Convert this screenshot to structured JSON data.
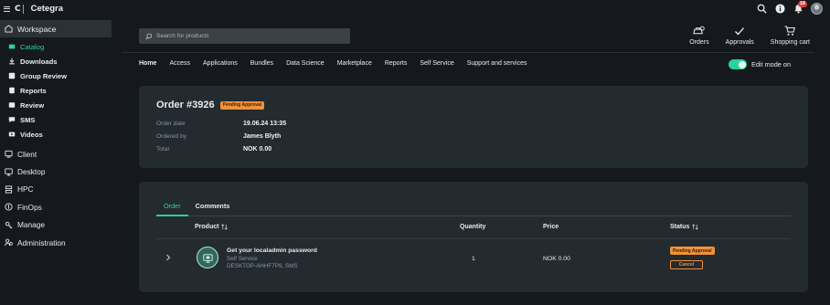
{
  "app": {
    "name": "Cetegra",
    "logo_letter": "C"
  },
  "topbar": {
    "notification_count": "18"
  },
  "sidebar": {
    "workspace": "Workspace",
    "sub_items": [
      {
        "label": "Catalog",
        "icon": "catalog-icon"
      },
      {
        "label": "Downloads",
        "icon": "download-icon"
      },
      {
        "label": "Group Review",
        "icon": "group-review-icon"
      },
      {
        "label": "Reports",
        "icon": "reports-icon"
      },
      {
        "label": "Review",
        "icon": "review-icon"
      },
      {
        "label": "SMS",
        "icon": "sms-icon"
      },
      {
        "label": "Videos",
        "icon": "videos-icon"
      }
    ],
    "main_items": [
      {
        "label": "Client",
        "icon": "client-icon"
      },
      {
        "label": "Desktop",
        "icon": "desktop-icon"
      },
      {
        "label": "HPC",
        "icon": "hpc-icon"
      },
      {
        "label": "FinOps",
        "icon": "finops-icon"
      },
      {
        "label": "Manage",
        "icon": "manage-icon"
      },
      {
        "label": "Administration",
        "icon": "administration-icon"
      }
    ]
  },
  "search": {
    "placeholder": "Search for products"
  },
  "actions": [
    {
      "label": "Orders",
      "icon": "orders-icon"
    },
    {
      "label": "Approvals",
      "icon": "check-icon"
    },
    {
      "label": "Shopping cart",
      "icon": "cart-icon"
    }
  ],
  "nav": {
    "items": [
      "Home",
      "Access",
      "Applications",
      "Bundles",
      "Data Science",
      "Marketplace",
      "Reports",
      "Self Service",
      "Support and services"
    ],
    "active": "Home",
    "edit_mode_label": "Edit mode on"
  },
  "order": {
    "title": "Order #3926",
    "status": "Pending Approval",
    "fields": [
      {
        "label": "Order date",
        "value": "19.06.24 13:35"
      },
      {
        "label": "Ordered by",
        "value": "James Blyth"
      },
      {
        "label": "Total",
        "value": "NOK 0.00"
      }
    ]
  },
  "order_items": {
    "tabs": [
      "Order",
      "Comments"
    ],
    "columns": {
      "product": "Product",
      "quantity": "Quantity",
      "price": "Price",
      "status": "Status"
    },
    "rows": [
      {
        "name": "Get your localadmin password",
        "category": "Self Service",
        "detail": "DESKTOP-AHHF7P9, SMS",
        "quantity": "1",
        "price": "NOK 0.00",
        "status": "Pending Approval",
        "action": "Cancel"
      }
    ]
  },
  "colors": {
    "accent": "#2bd29a",
    "warning": "#f0923a",
    "background": "#15191d",
    "card": "#232a30"
  }
}
